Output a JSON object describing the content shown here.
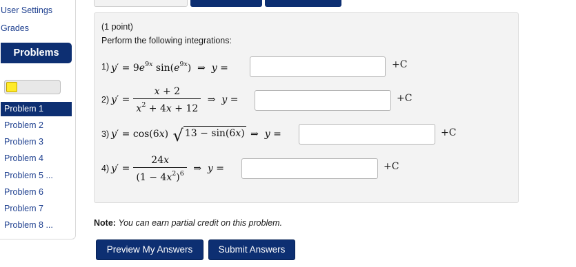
{
  "sidebar": {
    "links": [
      "User Settings",
      "Grades"
    ],
    "header": "Problems",
    "progress_fraction": 0.2,
    "problems": [
      "Problem 1",
      "Problem 2",
      "Problem 3",
      "Problem 4",
      "Problem 5 ...",
      "Problem 6",
      "Problem 7",
      "Problem 8 ..."
    ],
    "active_index": 0
  },
  "problem": {
    "points": "(1 point)",
    "instructions": "Perform the following integrations:",
    "items": [
      {
        "number": "1)",
        "answer_value": ""
      },
      {
        "number": "2)",
        "answer_value": ""
      },
      {
        "number": "3)",
        "answer_value": ""
      },
      {
        "number": "4)",
        "answer_value": ""
      }
    ],
    "plus_c": "+C"
  },
  "note": {
    "label": "Note:",
    "text": "You can earn partial credit on this problem."
  },
  "buttons": {
    "preview": "Preview My Answers",
    "submit": "Submit Answers"
  },
  "colors": {
    "accent": "#0d2f72",
    "link": "#1d3f8f",
    "progress_fill": "#ffeb2a",
    "box_bg": "#f3f3f3"
  }
}
